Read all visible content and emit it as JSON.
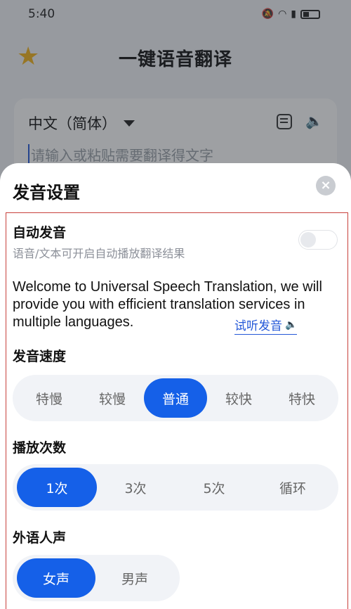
{
  "status_bar": {
    "time": "5:40",
    "icons": [
      "bell-muted-icon",
      "wifi-icon",
      "signal-icon",
      "battery-icon"
    ]
  },
  "app": {
    "title": "一键语音翻译",
    "source_language": "中文（简体）",
    "input_placeholder": "请输入或粘贴需要翻译得文字",
    "icons": [
      "star-icon",
      "keyboard-icon",
      "speaker-icon"
    ]
  },
  "sheet": {
    "title": "发音设置",
    "close_icon": "×",
    "auto_speak": {
      "label": "自动发音",
      "description": "语音/文本可开启自动播放翻译结果",
      "enabled": false
    },
    "sample": {
      "text": "Welcome to Universal Speech Translation, we will provide you with efficient translation services in multiple languages.",
      "listen_label": "试听发音"
    },
    "speed": {
      "label": "发音速度",
      "options": [
        "特慢",
        "较慢",
        "普通",
        "较快",
        "特快"
      ],
      "selected": "普通"
    },
    "repeat": {
      "label": "播放次数",
      "options": [
        "1次",
        "3次",
        "5次",
        "循环"
      ],
      "selected": "1次"
    },
    "voice": {
      "label": "外语人声",
      "options": [
        "女声",
        "男声"
      ],
      "selected": "女声"
    }
  },
  "colors": {
    "accent": "#1560e8",
    "link": "#2458d8",
    "frame": "#c8413c",
    "star": "#f2b21b"
  }
}
